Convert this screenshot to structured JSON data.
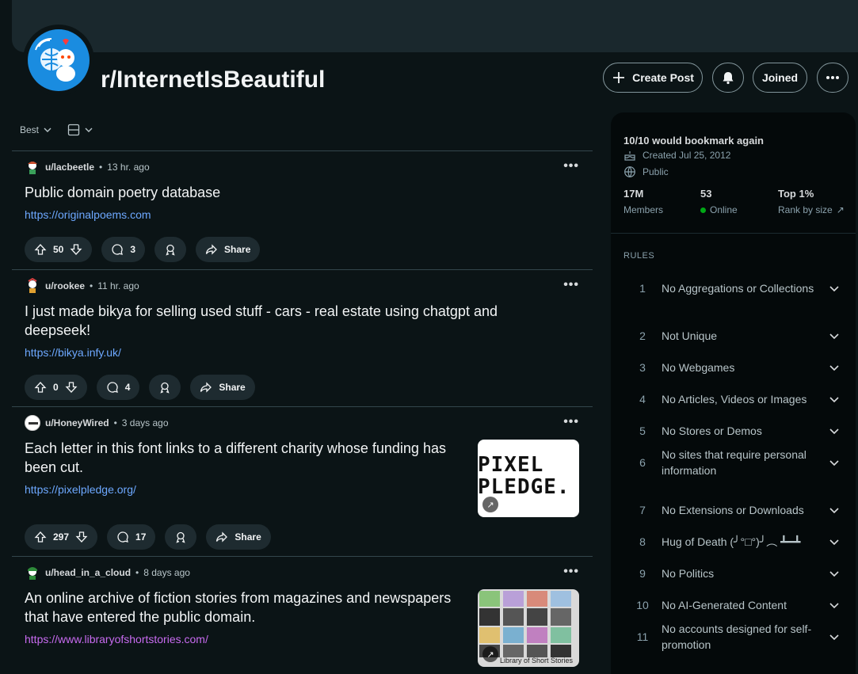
{
  "subreddit": {
    "name": "r/InternetIsBeautiful",
    "create_post_label": "Create Post",
    "joined_label": "Joined"
  },
  "sort": {
    "label": "Best"
  },
  "posts": [
    {
      "user": "u/lacbeetle",
      "age": "13 hr. ago",
      "title": "Public domain poetry database",
      "link": "https://originalpoems.com",
      "votes": "50",
      "comments": "3",
      "share": "Share"
    },
    {
      "user": "u/rookee",
      "age": "11 hr. ago",
      "title": "I just made bikya for selling used stuff - cars - real estate using chatgpt and deepseek!",
      "link": "https://bikya.infy.uk/",
      "votes": "0",
      "comments": "4",
      "share": "Share"
    },
    {
      "user": "u/HoneyWired",
      "age": "3 days ago",
      "title": "Each letter in this font links to a different charity whose funding has been cut.",
      "link": "https://pixelpledge.org/",
      "votes": "297",
      "comments": "17",
      "share": "Share",
      "thumb_text": [
        "PIXEL",
        "PLEDGE."
      ]
    },
    {
      "user": "u/head_in_a_cloud",
      "age": "8 days ago",
      "title": "An online archive of fiction stories from magazines and newspapers that have entered the public domain.",
      "link": "https://www.libraryofshortstories.com/",
      "thumb_caption": "Library of Short Stories"
    }
  ],
  "sidebar": {
    "title": "10/10 would bookmark again",
    "created": "Created Jul 25, 2012",
    "visibility": "Public",
    "members_value": "17M",
    "members_label": "Members",
    "online_value": "53",
    "online_label": "Online",
    "rank_value": "Top 1%",
    "rank_label": "Rank by size",
    "rules_heading": "RULES",
    "rules": [
      {
        "n": "1",
        "t": "No Aggregations or Collections"
      },
      {
        "n": "2",
        "t": "Not Unique"
      },
      {
        "n": "3",
        "t": "No Webgames"
      },
      {
        "n": "4",
        "t": "No Articles, Videos or Images"
      },
      {
        "n": "5",
        "t": "No Stores or Demos"
      },
      {
        "n": "6",
        "t": "No sites that require personal information"
      },
      {
        "n": "7",
        "t": "No Extensions or Downloads"
      },
      {
        "n": "8",
        "t": "Hug of Death (╯°□°)╯︵ ┻━┻"
      },
      {
        "n": "9",
        "t": "No Politics"
      },
      {
        "n": "10",
        "t": "No AI-Generated Content"
      },
      {
        "n": "11",
        "t": "No accounts designed for self-promotion"
      }
    ]
  },
  "colors": {
    "link": "#6da8ff",
    "visited_link": "#c86bf0",
    "online": "#01a816",
    "avatar_bg": "#1a8ce0"
  }
}
